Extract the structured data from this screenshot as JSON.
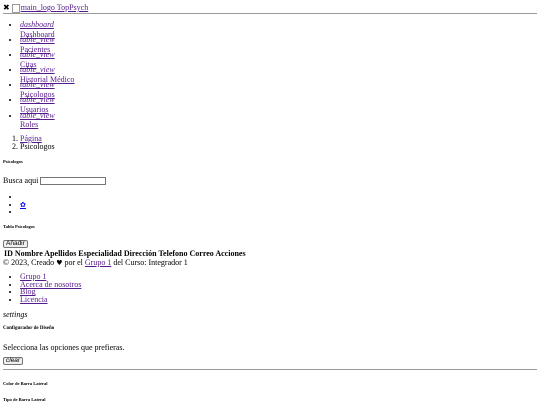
{
  "topbar": {
    "close_symbol": "✖",
    "logo_alt": "main_logo",
    "brand": "TopPsych"
  },
  "sidebar": {
    "items": [
      {
        "icon": "dashboard",
        "label": "Dashboard"
      },
      {
        "icon": "table_view",
        "label": "Pacientes"
      },
      {
        "icon": "table_view",
        "label": "Citas"
      },
      {
        "icon": "table_view",
        "label": "Historial Médico"
      },
      {
        "icon": "table_view",
        "label": "Psicologos"
      },
      {
        "icon": "table_view",
        "label": "Usuarios"
      },
      {
        "icon": "table_view",
        "label": "Roles"
      }
    ]
  },
  "breadcrumb": {
    "items": [
      "Página",
      "Psicologos"
    ]
  },
  "page": {
    "title": "Psicologos",
    "search_label": "Busca aqui",
    "search_value": "",
    "gear_glyph": "✿"
  },
  "table": {
    "title": "Tabla Psicologos",
    "add_label": "Añadir",
    "headers": "ID Nombre Apellidos Especialidad Dirección Telefono Correo Acciones"
  },
  "footer": {
    "prefix": "© 2023, Creado",
    "heart": "♥",
    "por_el": "por el",
    "group_link": "Grupo 1",
    "suffix": "del Curso: Integrador 1",
    "links": [
      "Grupo 1",
      "Acerca de nosotros",
      "Blog",
      "Licencia"
    ]
  },
  "configurator": {
    "toggle_icon": "settings",
    "title": "Configurador de Diseño",
    "subtitle": "Selecciona las opciones que prefieras.",
    "clear_label": "clear",
    "section_sidebar_color": "Color de Barra Lateral",
    "section_sidebar_type": "Tipo de Barra Lateral"
  }
}
